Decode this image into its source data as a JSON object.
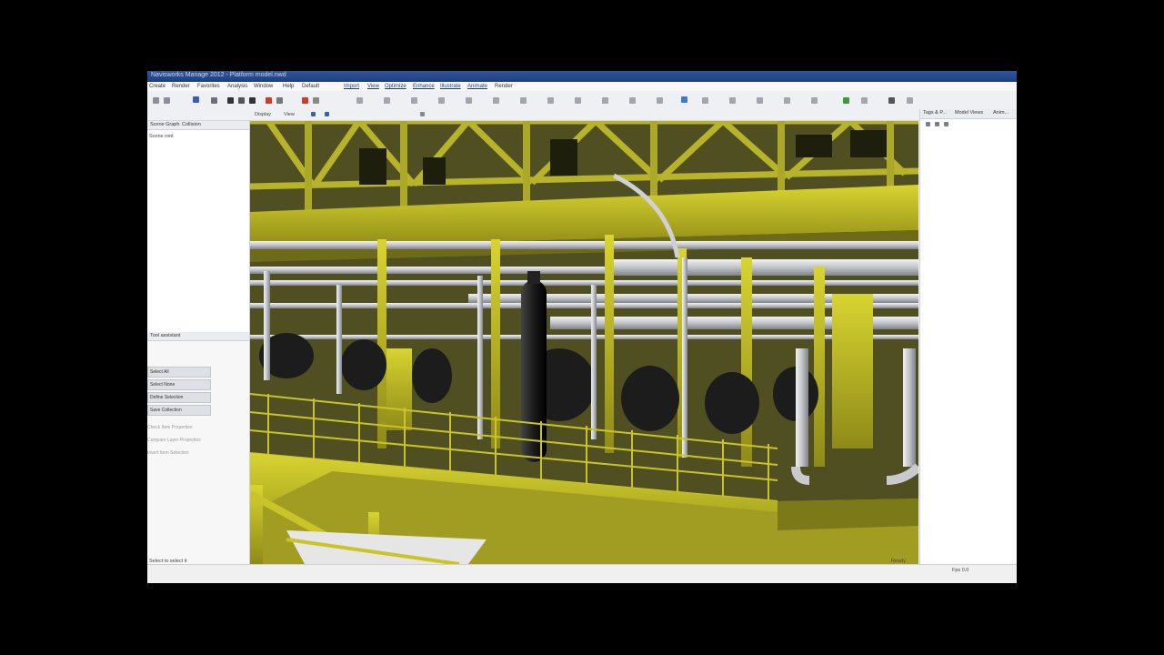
{
  "window": {
    "title": "Navisworks Manage 2012 - Platform model.nwd"
  },
  "menu": {
    "items": [
      "Create",
      "Render",
      "Favorites",
      "Analysis",
      "Window",
      "Help",
      "Default",
      "Import",
      "View",
      "Optimize",
      "Enhance",
      "Illustrate",
      "Animate",
      "Render"
    ]
  },
  "toolbar": {
    "row2": [
      "Display",
      "View"
    ]
  },
  "left_panel": {
    "tabs": [
      "Scene Graph",
      "Collision"
    ],
    "tree_items": [
      "Scene root"
    ],
    "assistant_title": "Tool assistant",
    "assistant_buttons": [
      "Select All",
      "Select None",
      "Define Selection",
      "Save Collection"
    ],
    "assistant_options": [
      "Check Item Properties",
      "Compare Layer Properties",
      "Invert Item Selection"
    ]
  },
  "right_panel": {
    "tabs": [
      "Tags & P...",
      "Model Views",
      "Anim..."
    ]
  },
  "status": {
    "left": "Select to select it",
    "right_1": "Ready",
    "right_2": "Fps 0.0"
  },
  "colors": {
    "titlebar": "#1e3f7f",
    "steel": "#c9c428",
    "steel_dark": "#8e8a18",
    "pipe": "#d0d2d5",
    "vessel": "#1a1a1a"
  }
}
